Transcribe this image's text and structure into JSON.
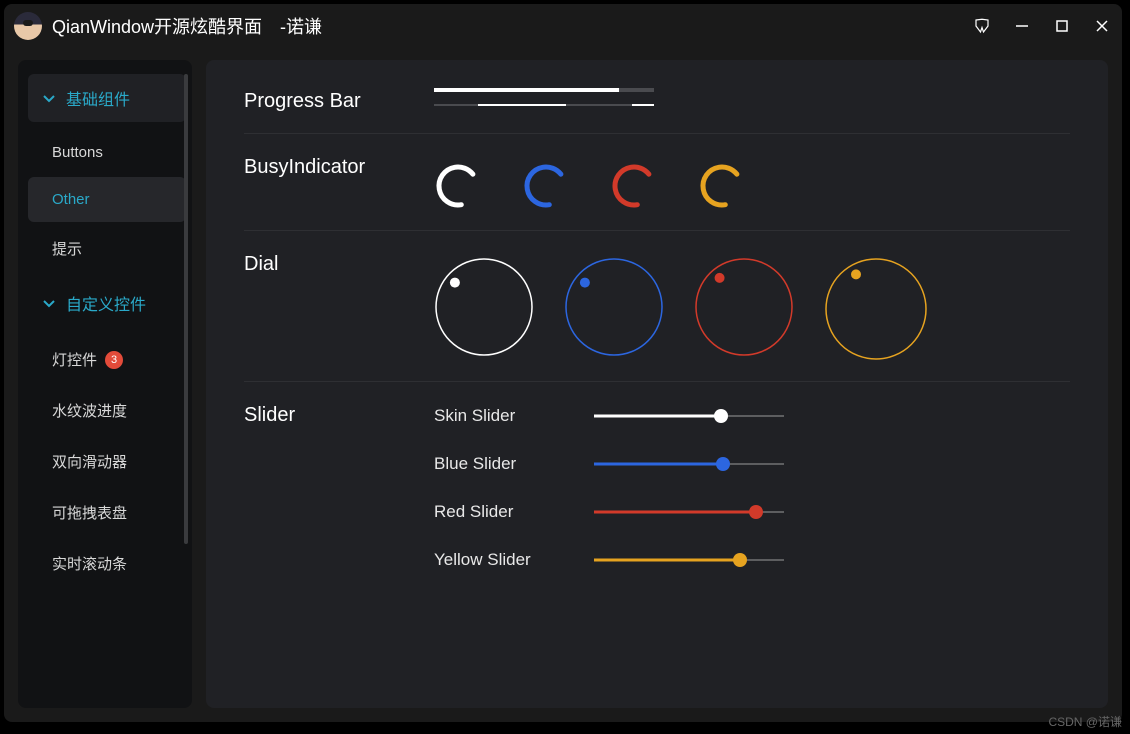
{
  "titlebar": {
    "main": "QianWindow开源炫酷界面",
    "sub": "-诺谦"
  },
  "sidebar": {
    "groups": [
      {
        "label": "基础组件",
        "items": [
          {
            "label": "Buttons"
          },
          {
            "label": "Other",
            "active": true
          },
          {
            "label": "提示"
          }
        ]
      },
      {
        "label": "自定义控件",
        "items": [
          {
            "label": "灯控件",
            "badge": "3"
          },
          {
            "label": "水纹波进度"
          },
          {
            "label": "双向滑动器"
          },
          {
            "label": "可拖拽表盘"
          },
          {
            "label": "实时滚动条"
          }
        ]
      }
    ]
  },
  "sections": {
    "progress": {
      "title": "Progress Bar",
      "bars": [
        {
          "type": "fill",
          "value": 84
        },
        {
          "type": "range",
          "start": 20,
          "end": 60,
          "extra_start": 90,
          "extra_end": 100
        }
      ]
    },
    "busy": {
      "title": "BusyIndicator",
      "colors": [
        "#ffffff",
        "#2c66e0",
        "#d23a2a",
        "#e6a320"
      ]
    },
    "dial": {
      "title": "Dial",
      "items": [
        {
          "color": "#ffffff",
          "size": 100,
          "angle": 220
        },
        {
          "color": "#2c66e0",
          "size": 100,
          "angle": 220
        },
        {
          "color": "#d23a2a",
          "size": 100,
          "angle": 230
        },
        {
          "color": "#e6a320",
          "size": 104,
          "angle": 240
        }
      ]
    },
    "slider": {
      "title": "Slider",
      "sliders": [
        {
          "label": "Skin Slider",
          "color": "#ffffff",
          "value": 67
        },
        {
          "label": "Blue Slider",
          "color": "#2c66e0",
          "value": 68
        },
        {
          "label": "Red Slider",
          "color": "#d23a2a",
          "value": 85
        },
        {
          "label": "Yellow Slider",
          "color": "#e6a320",
          "value": 77
        }
      ]
    }
  },
  "watermark": "CSDN @诺谦"
}
